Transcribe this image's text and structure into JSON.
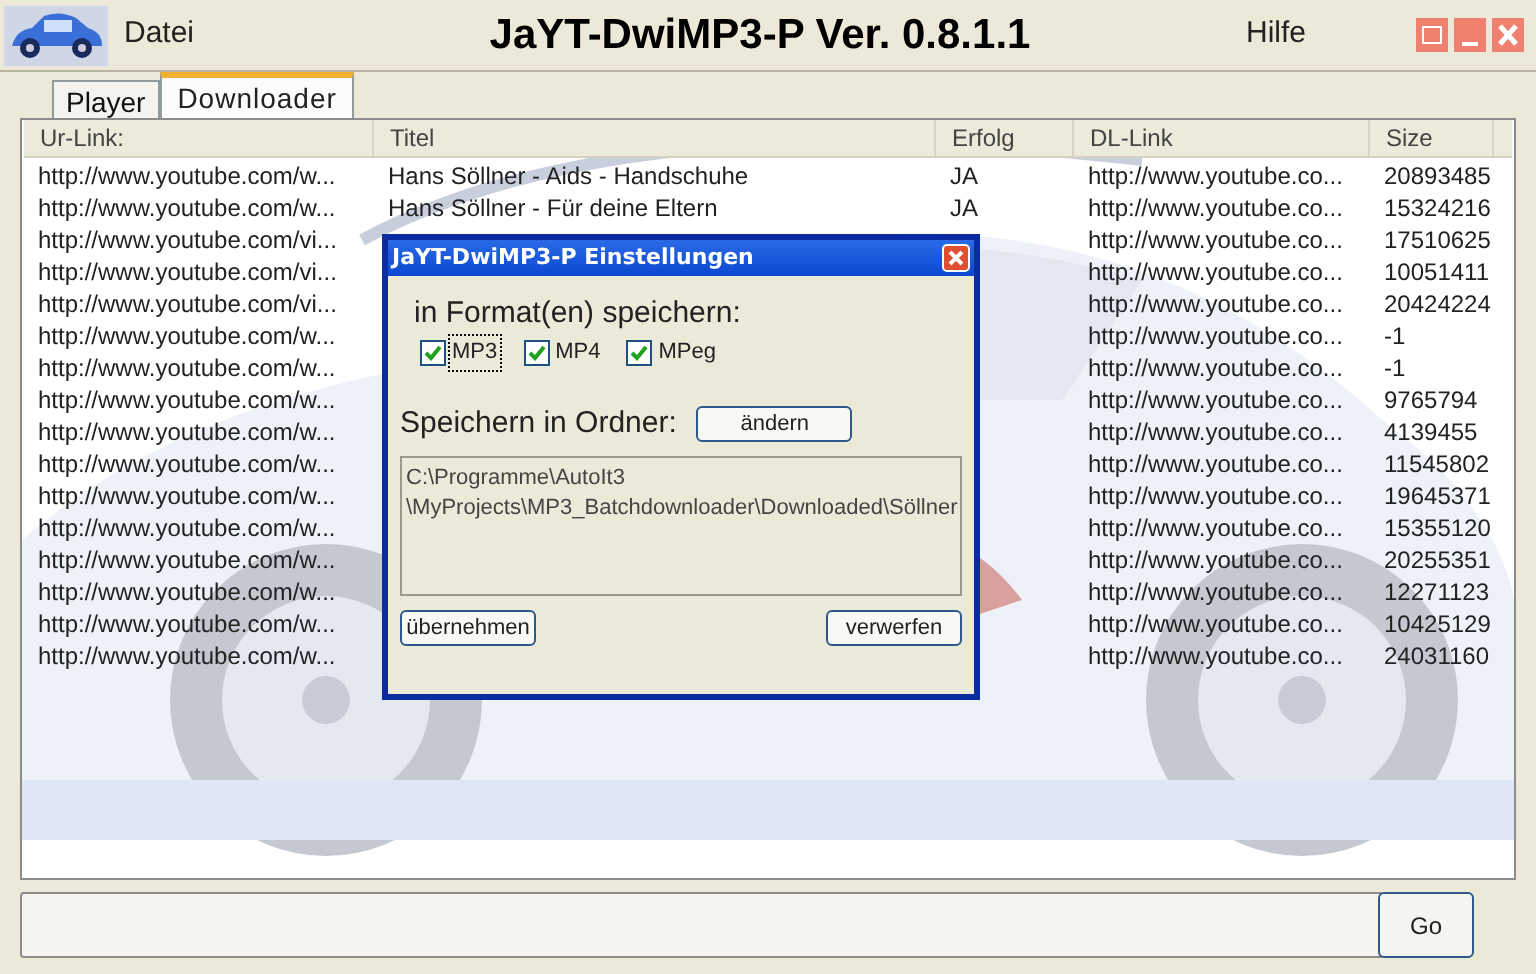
{
  "menu_bar": {
    "title": "JaYT-DwiMP3-P Ver. 0.8.1.1",
    "items": [
      "Datei",
      "Hilfe"
    ]
  },
  "tabs": [
    {
      "label": "Player",
      "selected": false
    },
    {
      "label": "Downloader",
      "selected": true
    }
  ],
  "table": {
    "columns": [
      "Ur-Link:",
      "Titel",
      "Erfolg",
      "DL-Link",
      "Size"
    ],
    "rows": [
      {
        "ur_link": "http://www.youtube.com/w...",
        "titel": "Hans Söllner - Aids - Handschuhe",
        "erfolg": "JA",
        "dl_link": "http://www.youtube.co...",
        "size": "20893485"
      },
      {
        "ur_link": "http://www.youtube.com/w...",
        "titel": "Hans Söllner - Für deine Eltern",
        "erfolg": "JA",
        "dl_link": "http://www.youtube.co...",
        "size": "15324216"
      },
      {
        "ur_link": "http://www.youtube.com/vi...",
        "dl_link": "http://www.youtube.co...",
        "size": "17510625"
      },
      {
        "ur_link": "http://www.youtube.com/vi...",
        "dl_link": "http://www.youtube.co...",
        "size": "10051411"
      },
      {
        "ur_link": "http://www.youtube.com/vi...",
        "dl_link": "http://www.youtube.co...",
        "size": "20424224"
      },
      {
        "ur_link": "http://www.youtube.com/w...",
        "dl_link": "http://www.youtube.co...",
        "size": "-1"
      },
      {
        "ur_link": "http://www.youtube.com/w...",
        "dl_link": "http://www.youtube.co...",
        "size": "-1"
      },
      {
        "ur_link": "http://www.youtube.com/w...",
        "dl_link": "http://www.youtube.co...",
        "size": "9765794"
      },
      {
        "ur_link": "http://www.youtube.com/w...",
        "dl_link": "http://www.youtube.co...",
        "size": "4139455"
      },
      {
        "ur_link": "http://www.youtube.com/w...",
        "dl_link": "http://www.youtube.co...",
        "size": "11545802"
      },
      {
        "ur_link": "http://www.youtube.com/w...",
        "dl_link": "http://www.youtube.co...",
        "size": "19645371"
      },
      {
        "ur_link": "http://www.youtube.com/w...",
        "dl_link": "http://www.youtube.co...",
        "size": "15355120"
      },
      {
        "ur_link": "http://www.youtube.com/w...",
        "dl_link": "http://www.youtube.co...",
        "size": "20255351"
      },
      {
        "ur_link": "http://www.youtube.com/w...",
        "dl_link": "http://www.youtube.co...",
        "size": "12271123"
      },
      {
        "ur_link": "http://www.youtube.com/w...",
        "dl_link": "http://www.youtube.co...",
        "size": "10425129"
      },
      {
        "ur_link": "http://www.youtube.com/w...",
        "dl_link": "http://www.youtube.co...",
        "size": "24031160"
      }
    ]
  },
  "go_button": "Go",
  "dialog": {
    "title": "JaYT-DwiMP3-P Einstellungen",
    "format_label": "in Format(en) speichern:",
    "formats": [
      {
        "label": "MP3",
        "checked": true,
        "focused": true
      },
      {
        "label": "MP4",
        "checked": true,
        "focused": false
      },
      {
        "label": "MPeg",
        "checked": true,
        "focused": false
      }
    ],
    "folder_label": "Speichern in Ordner:",
    "change_button": "ändern",
    "path_lines": [
      "C:\\Programme\\AutoIt3",
      "\\MyProjects\\MP3_Batchdownloader\\Downloaded\\Söllner"
    ],
    "apply_button": "übernehmen",
    "discard_button": "verwerfen"
  }
}
